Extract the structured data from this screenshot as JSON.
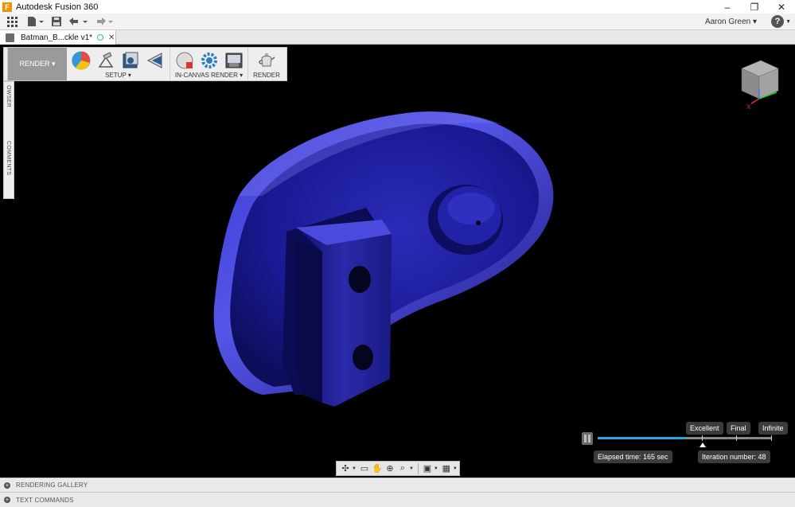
{
  "window": {
    "app_logo": "F",
    "title": "Autodesk Fusion 360",
    "minimize_icon": "–",
    "restore_icon": "❐",
    "close_icon": "✕"
  },
  "quick_access": {
    "user_name": "Aaron Green ▾",
    "help_label": "?",
    "help_caret": "▼"
  },
  "document_tab": {
    "label": "Batman_B...ckle v1*",
    "close_icon": "✕"
  },
  "ribbon": {
    "workspace_label": "RENDER ▾",
    "groups": {
      "setup": "SETUP ▾",
      "in_canvas_render": "IN-CANVAS RENDER ▾",
      "render": "RENDER"
    }
  },
  "side_panel": {
    "browser_label": "OWSER",
    "comments_label": "COMMENTS"
  },
  "view_cube": {
    "x_axis_label": "X"
  },
  "render_progress": {
    "fraction_complete": 0.5,
    "quality_levels": [
      "Excellent",
      "Final",
      "Infinite"
    ],
    "current_quality": "Excellent",
    "elapsed_time": "Elapsed time: 165 sec",
    "iteration_number": "Iteration number: 48"
  },
  "bottom_panels": {
    "rendering_gallery": "RENDERING GALLERY",
    "text_commands": "TEXT COMMANDS"
  },
  "colors": {
    "model": "#1c1ca0",
    "progress_fill": "#27a6e6",
    "background": "#000000"
  }
}
